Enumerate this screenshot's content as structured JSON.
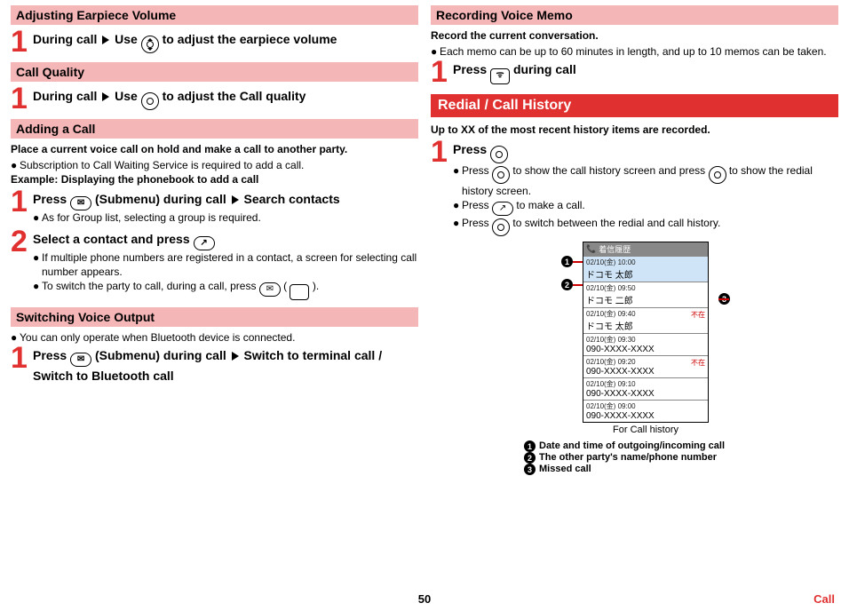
{
  "left": {
    "sec1": {
      "title": "Adjusting Earpiece Volume",
      "step1_a": "During call",
      "step1_b": "Use",
      "step1_c": "to adjust the earpiece volume"
    },
    "sec2": {
      "title": "Call Quality",
      "step1_a": "During call",
      "step1_b": "Use",
      "step1_c": "to adjust the Call quality"
    },
    "sec3": {
      "title": "Adding a Call",
      "lead": "Place a current voice call on hold and make a call to another party.",
      "b1": "Subscription to Call Waiting Service is required to add a call.",
      "example": "Example: Displaying the phonebook to add a call",
      "s1_a": "Press",
      "s1_b": "(Submenu) during call",
      "s1_c": "Search contacts",
      "s1_note": "As for Group list, selecting a group is required.",
      "s2_a": "Select a contact and press",
      "s2_n1": "If multiple phone numbers are registered in a contact, a screen for selecting call number appears.",
      "s2_n2a": "To switch the party to call, during a call, press",
      "s2_n2b": "(",
      "s2_n2c": ")."
    },
    "sec4": {
      "title": "Switching Voice Output",
      "b1": "You can only operate when Bluetooth device is connected.",
      "s1_a": "Press",
      "s1_b": "(Submenu) during call",
      "s1_c": "Switch to terminal call / Switch to Bluetooth call"
    }
  },
  "right": {
    "sec1": {
      "title": "Recording Voice Memo",
      "lead": "Record the current conversation.",
      "b1": "Each memo can be up to 60 minutes in length, and up to 10 memos can be taken.",
      "s1_a": "Press",
      "s1_b": "during call"
    },
    "sec2": {
      "title": "Redial / Call History",
      "lead": "Up to XX of the most recent history items are recorded.",
      "s1_a": "Press",
      "s1_n1a": "Press",
      "s1_n1b": "to show the call history screen and press",
      "s1_n1c": "to show the redial history screen.",
      "s1_n2a": "Press",
      "s1_n2b": "to make a call.",
      "s1_n3a": "Press",
      "s1_n3b": "to switch between the redial and call history.",
      "screen": {
        "bar": "着信履歴",
        "rows": [
          {
            "dt": "02/10(金) 10:00",
            "nm": "ドコモ 太郎",
            "miss": "",
            "hl": true
          },
          {
            "dt": "02/10(金) 09:50",
            "nm": "ドコモ 二郎",
            "miss": "",
            "hl": false
          },
          {
            "dt": "02/10(金) 09:40",
            "nm": "ドコモ 太郎",
            "miss": "不在",
            "hl": false
          },
          {
            "dt": "02/10(金) 09:30",
            "nm": "090-XXXX-XXXX",
            "miss": "",
            "hl": false
          },
          {
            "dt": "02/10(金) 09:20",
            "nm": "090-XXXX-XXXX",
            "miss": "不在",
            "hl": false
          },
          {
            "dt": "02/10(金) 09:10",
            "nm": "090-XXXX-XXXX",
            "miss": "",
            "hl": false
          },
          {
            "dt": "02/10(金) 09:00",
            "nm": "090-XXXX-XXXX",
            "miss": "",
            "hl": false
          }
        ],
        "caption": "For Call history"
      },
      "legend": {
        "l1": "Date and time of outgoing/incoming call",
        "l2": "The other party's name/phone number",
        "l3": "Missed call"
      }
    }
  },
  "footer": {
    "page": "50",
    "section": "Call"
  }
}
